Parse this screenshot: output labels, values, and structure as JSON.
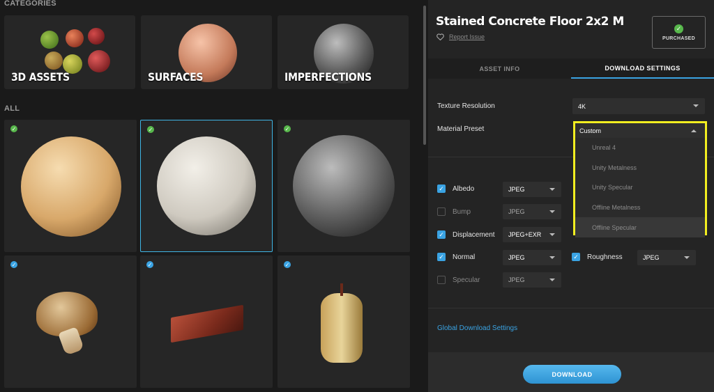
{
  "categories": {
    "title": "CATEGORIES",
    "items": [
      {
        "label": "3D ASSETS"
      },
      {
        "label": "SURFACES"
      },
      {
        "label": "IMPERFECTIONS"
      }
    ]
  },
  "all": {
    "title": "ALL"
  },
  "asset": {
    "title": "Stained Concrete Floor 2x2 M",
    "report": "Report Issue",
    "purchased": "PURCHASED"
  },
  "tabs": {
    "info": "ASSET INFO",
    "download": "DOWNLOAD SETTINGS"
  },
  "settings": {
    "resolution_label": "Texture Resolution",
    "resolution_value": "4K",
    "preset_label": "Material Preset",
    "preset_value": "Custom",
    "preset_options": [
      "Unreal 4",
      "Unity Metalness",
      "Unity Specular",
      "Offline Metalness",
      "Offline Specular"
    ]
  },
  "maps": {
    "albedo": {
      "label": "Albedo",
      "format": "JPEG"
    },
    "bump": {
      "label": "Bump",
      "format": "JPEG"
    },
    "displacement": {
      "label": "Displacement",
      "format": "JPEG+EXR"
    },
    "normal": {
      "label": "Normal",
      "format": "JPEG"
    },
    "specular": {
      "label": "Specular",
      "format": "JPEG"
    },
    "roughness": {
      "label": "Roughness",
      "format": "JPEG"
    }
  },
  "global_link": "Global Download Settings",
  "download_button": "DOWNLOAD",
  "colors": {
    "accent": "#3aa3e3",
    "purchased_green": "#58b84c",
    "highlight_yellow": "#f2ee20"
  }
}
